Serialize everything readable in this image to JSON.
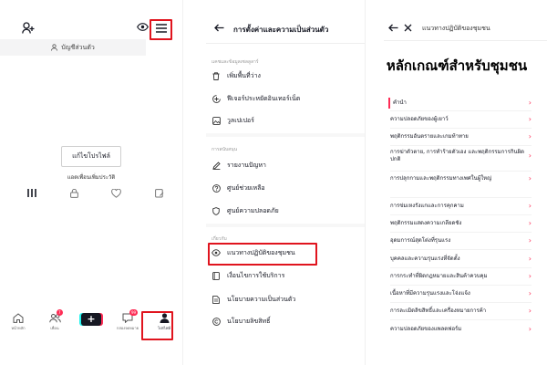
{
  "profile": {
    "account_switch_label": "บัญชีส่วนตัว",
    "edit_profile_label": "แก้ไขโปรไฟล์",
    "add_friends_text": "แอดเพื่อนเพิ่มประวัติ",
    "nav": [
      {
        "label": "หน้าหลัก",
        "badge": ""
      },
      {
        "label": "เพื่อน",
        "badge": "7"
      },
      {
        "label": "",
        "badge": ""
      },
      {
        "label": "กล่องจดหมาย",
        "badge": "99"
      },
      {
        "label": "โปรไฟล์",
        "badge": ""
      }
    ]
  },
  "settings": {
    "title": "การตั้งค่าและความเป็นส่วนตัว",
    "sections": [
      {
        "label": "แคชและข้อมูลเซลลูลาร์",
        "items": [
          {
            "label": "เพิ่มพื้นที่ว่าง",
            "icon": "trash-icon"
          },
          {
            "label": "ฟีเจอร์ประหยัดอินเทอร์เน็ต",
            "icon": "data-saver-icon"
          },
          {
            "label": "วูลเปเปอร์",
            "icon": "wallpaper-icon"
          }
        ]
      },
      {
        "label": "การสนับสนุน",
        "items": [
          {
            "label": "รายงานปัญหา",
            "icon": "pencil-icon"
          },
          {
            "label": "ศูนย์ช่วยเหลือ",
            "icon": "help-icon"
          },
          {
            "label": "ศูนย์ความปลอดภัย",
            "icon": "shield-icon"
          }
        ]
      },
      {
        "label": "เกี่ยวกับ",
        "items": [
          {
            "label": "แนวทางปฏิบัติของชุมชน",
            "icon": "community-icon"
          },
          {
            "label": "เงื่อนไขการใช้บริการ",
            "icon": "book-icon"
          },
          {
            "label": "นโยบายความเป็นส่วนตัว",
            "icon": "document-icon"
          },
          {
            "label": "นโยบายลิขสิทธิ์",
            "icon": "copyright-icon"
          }
        ]
      }
    ]
  },
  "guidelines": {
    "title": "แนวทางปฏิบัติของชุมชน",
    "heading": "หลักเกณฑ์สำหรับชุมชน",
    "items": [
      "คำนำ",
      "ความปลอดภัยของผู้เยาว์",
      "พฤติกรรมอันตรายและเกมท้าทาย",
      "การฆ่าตัวตาย, การทำร้ายตัวเอง และพฤติกรรมการกินผิดปกติ",
      "การปลุกกามและพฤติกรรมทางเพศในผู้ใหญ่",
      "การข่มเหงรังแกและการคุกคาม",
      "พฤติกรรมแสดงความเกลียดชัง",
      "อุดมการณ์สุดโต่งที่รุนแรง",
      "บุคคลและความรุนแรงที่จัดตั้ง",
      "การกระทำที่ผิดกฎหมายและสินค้าควบคุม",
      "เนื้อหาที่มีความรุนแรงและโจ่งแจ้ง",
      "การละเมิดลิขสิทธิ์และเครื่องหมายการค้า",
      "ความปลอดภัยของแพลตฟอร์ม"
    ]
  },
  "colors": {
    "accent": "#fe2c55",
    "highlight_box": "#e0141e"
  }
}
